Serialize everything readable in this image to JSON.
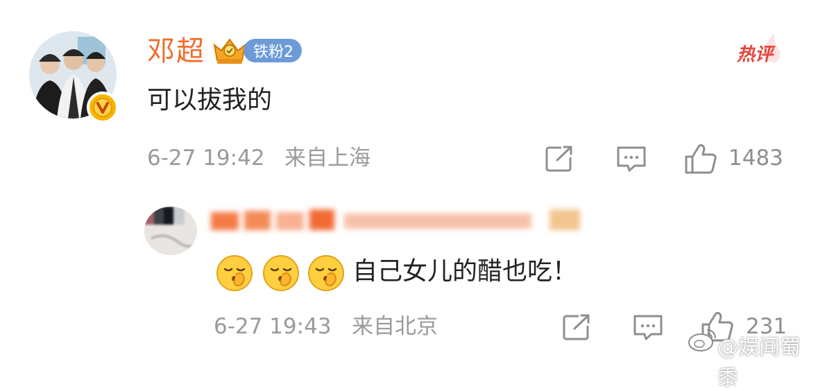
{
  "comment": {
    "username": "邓超",
    "fan_badge": "铁粉2",
    "hot_tag": "热评",
    "text": "可以拔我的",
    "timestamp": "6-27 19:42",
    "location": "来自上海",
    "like_count": "1483"
  },
  "reply": {
    "text": "自己女儿的醋也吃！",
    "timestamp": "6-27 19:43",
    "location": "来自北京",
    "like_count": "231",
    "emoji_icons": [
      "shush-emoji",
      "shush-emoji",
      "shush-emoji"
    ]
  },
  "watermark": "@娱闻蜀黍",
  "colors": {
    "username": "#f06d2c",
    "meta_gray": "#9a9a9a",
    "hot_red": "#e8443a",
    "badge_blue": "#6d9bd8",
    "verify_gold": "#f7b500"
  }
}
